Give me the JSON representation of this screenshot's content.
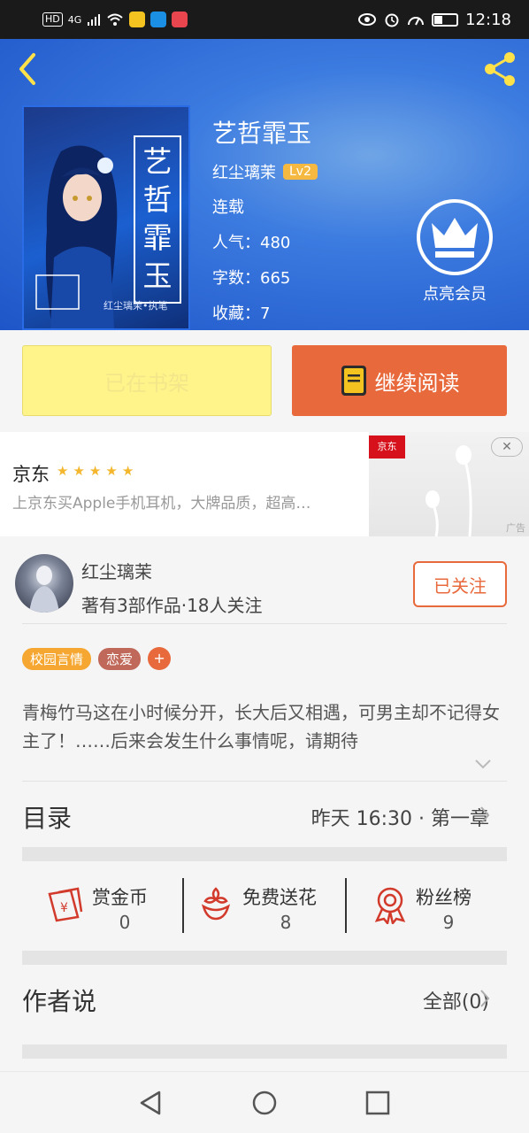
{
  "status_bar": {
    "network_label": "HD",
    "signal_label": "4G",
    "time": "12:18"
  },
  "header": {
    "back_icon": "back-chevron-icon",
    "share_icon": "share-icon",
    "cover": {
      "title_vertical": [
        "艺",
        "哲",
        "霏",
        "玉"
      ],
      "caption": "红尘璃茉•执笔"
    },
    "book_title": "艺哲霏玉",
    "author": "红尘璃茉",
    "level": "Lv2",
    "status": "连载",
    "popularity": "人气：480",
    "word_count": "字数：665",
    "favorites": "收藏：7",
    "vip_label": "点亮会员"
  },
  "actions": {
    "shelf_label": "已在书架",
    "read_label": "继续阅读"
  },
  "ad": {
    "brand": "京东",
    "text": "上京东买Apple手机耳机，大牌品质，超高…",
    "logo_text": "京东",
    "close_label": "✕",
    "tag": "广告"
  },
  "author_card": {
    "name": "红尘璃茉",
    "stats": "著有3部作品·18人关注",
    "follow_label": "已关注"
  },
  "tags": [
    {
      "label": "校园言情",
      "color": "#f5a731"
    },
    {
      "label": "恋爱",
      "color": "#c0695a"
    }
  ],
  "tag_plus": "+",
  "intro": "青梅竹马这在小时候分开，长大后又相遇，可男主却不记得女主了！……后来会发生什么事情呢，请期待",
  "toc": {
    "title": "目录",
    "latest": "昨天 16:30 · 第一章"
  },
  "stats": [
    {
      "label": "赏金币",
      "value": "0",
      "icon": "reward-coin-icon"
    },
    {
      "label": "免费送花",
      "value": "8",
      "icon": "flower-icon"
    },
    {
      "label": "粉丝榜",
      "value": "9",
      "icon": "fan-badge-icon"
    }
  ],
  "author_says": {
    "title": "作者说",
    "all_label": "全部(0)"
  },
  "colors": {
    "accent": "#e8693c",
    "header_blue": "#1e55c8",
    "shelf_yellow": "#fff48a",
    "level_badge": "#f5b942"
  }
}
